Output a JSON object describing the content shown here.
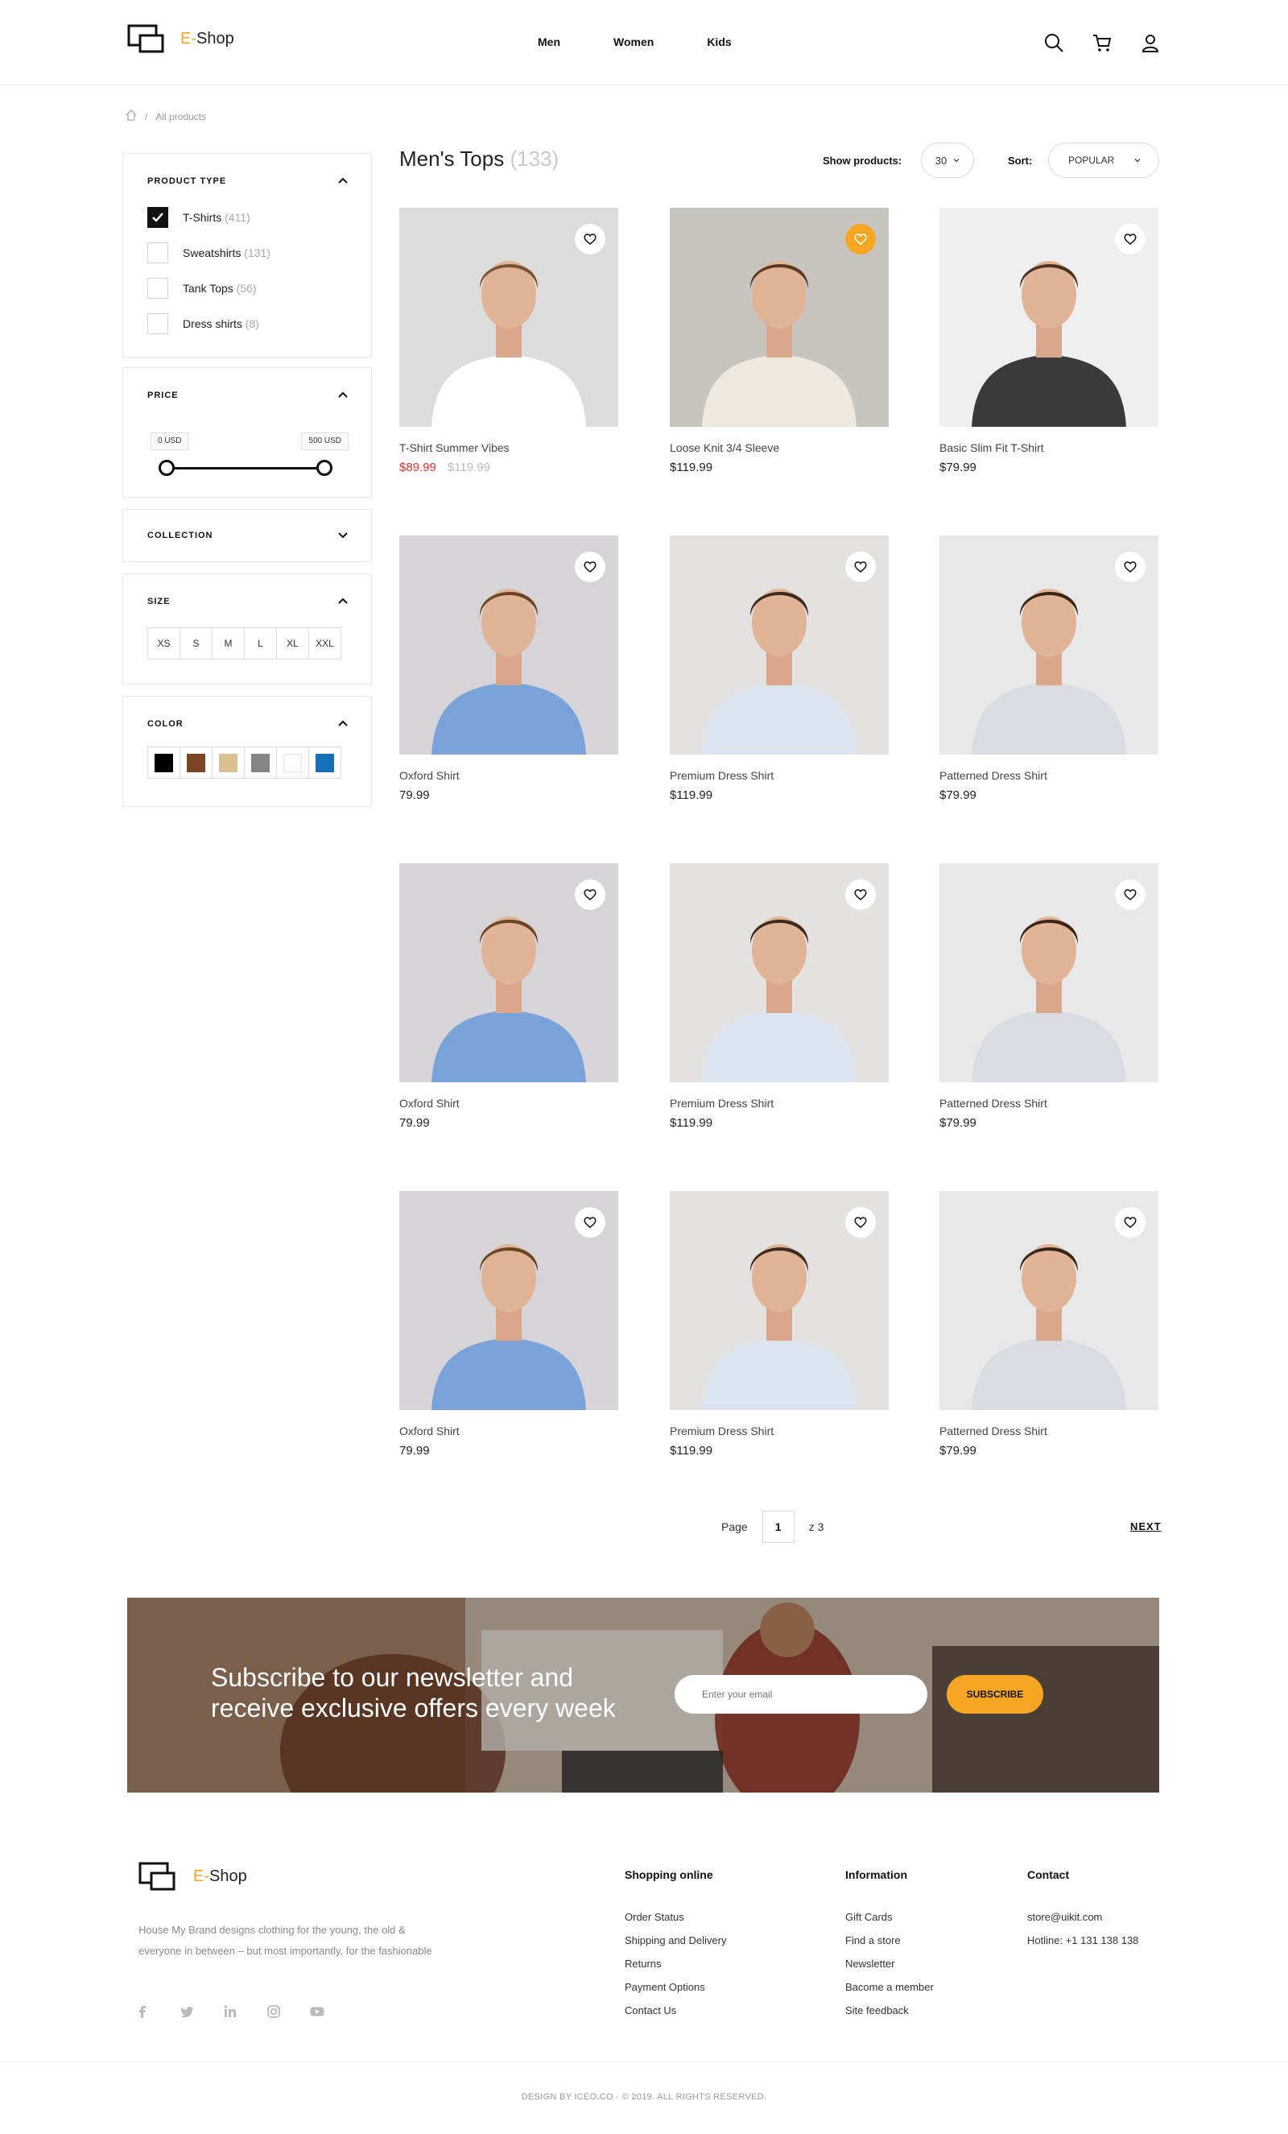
{
  "brand": {
    "prefix": "E-",
    "name": "Shop",
    "accent": "#f5a623"
  },
  "nav": [
    {
      "label": "Men"
    },
    {
      "label": "Women"
    },
    {
      "label": "Kids"
    }
  ],
  "header_icons": [
    "search-icon",
    "cart-icon",
    "user-icon"
  ],
  "breadcrumb": {
    "home_icon": "home-icon",
    "separator": "/",
    "current": "All products"
  },
  "filters": {
    "product_type": {
      "title": "PRODUCT TYPE",
      "options": [
        {
          "label": "T-Shirts",
          "count": "(411)",
          "checked": true
        },
        {
          "label": "Sweatshirts",
          "count": "(131)",
          "checked": false
        },
        {
          "label": "Tank Tops",
          "count": "(56)",
          "checked": false
        },
        {
          "label": "Dress shirts",
          "count": "(8)",
          "checked": false
        }
      ]
    },
    "price": {
      "title": "PRICE",
      "min_label": "0 USD",
      "max_label": "500 USD",
      "min": 0,
      "max": 500
    },
    "collection": {
      "title": "COLLECTION"
    },
    "size": {
      "title": "SIZE",
      "options": [
        "XS",
        "S",
        "M",
        "L",
        "XL",
        "XXL"
      ]
    },
    "color": {
      "title": "COLOR",
      "swatches": [
        "#000000",
        "#7a4520",
        "#d9c28f",
        "#858585",
        "#ffffff",
        "#1670b8"
      ]
    }
  },
  "listing": {
    "title": "Men's Tops",
    "count": "(133)",
    "show_label": "Show products:",
    "show_value": "30",
    "sort_label": "Sort:",
    "sort_value": "POPULAR"
  },
  "products": [
    {
      "name": "T-Shirt Summer Vibes",
      "price": "$89.99",
      "old_price": "$119.99",
      "sale": true,
      "wishlisted": false
    },
    {
      "name": "Loose Knit 3/4 Sleeve",
      "price": "$119.99",
      "old_price": "",
      "sale": false,
      "wishlisted": true
    },
    {
      "name": "Basic Slim Fit T-Shirt",
      "price": "$79.99",
      "old_price": "",
      "sale": false,
      "wishlisted": false
    },
    {
      "name": "Oxford Shirt",
      "price": "79.99",
      "old_price": "",
      "sale": false,
      "wishlisted": false
    },
    {
      "name": "Premium Dress Shirt",
      "price": "$119.99",
      "old_price": "",
      "sale": false,
      "wishlisted": false
    },
    {
      "name": "Patterned Dress Shirt",
      "price": "$79.99",
      "old_price": "",
      "sale": false,
      "wishlisted": false
    },
    {
      "name": "Oxford Shirt",
      "price": "79.99",
      "old_price": "",
      "sale": false,
      "wishlisted": false
    },
    {
      "name": "Premium Dress Shirt",
      "price": "$119.99",
      "old_price": "",
      "sale": false,
      "wishlisted": false
    },
    {
      "name": "Patterned Dress Shirt",
      "price": "$79.99",
      "old_price": "",
      "sale": false,
      "wishlisted": false
    },
    {
      "name": "Oxford Shirt",
      "price": "79.99",
      "old_price": "",
      "sale": false,
      "wishlisted": false
    },
    {
      "name": "Premium Dress Shirt",
      "price": "$119.99",
      "old_price": "",
      "sale": false,
      "wishlisted": false
    },
    {
      "name": "Patterned Dress Shirt",
      "price": "$79.99",
      "old_price": "",
      "sale": false,
      "wishlisted": false
    }
  ],
  "pagination": {
    "label": "Page",
    "current": "1",
    "total": "z 3",
    "next": "NEXT"
  },
  "newsletter": {
    "title": "Subscribe to our newsletter and receive exclusive offers every week",
    "placeholder": "Enter your email",
    "button": "SUBSCRIBE"
  },
  "footer": {
    "description": "House My Brand designs clothing for the young, the old & everyone in between – but most importantly, for the fashionable",
    "social": [
      "facebook-icon",
      "twitter-icon",
      "linkedin-icon",
      "instagram-icon",
      "youtube-icon"
    ],
    "shopping": {
      "title": "Shopping online",
      "links": [
        "Order Status",
        "Shipping and Delivery",
        "Returns",
        "Payment Options",
        "Contact Us"
      ]
    },
    "information": {
      "title": "Information",
      "links": [
        "Gift Cards",
        "Find a store",
        "Newsletter",
        "Bacome a member",
        "Site feedback"
      ]
    },
    "contact": {
      "title": "Contact",
      "email": "store@uikit.com",
      "hotline": "Hotline: +1 131 138 138"
    },
    "copyright": "DESIGN BY ICEO.CO - © 2019. ALL RIGHTS RESERVED."
  }
}
